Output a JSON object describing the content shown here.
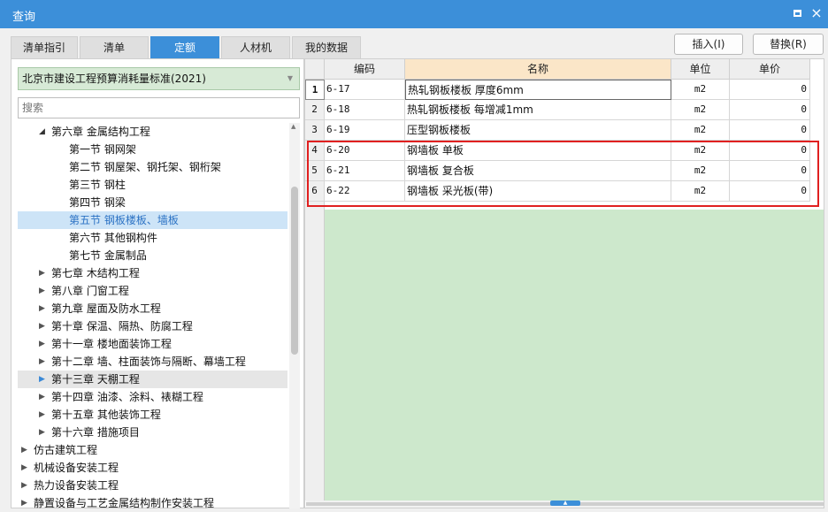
{
  "window": {
    "title": "查询",
    "maximize_label": "",
    "close_label": "×"
  },
  "tabs": [
    "清单指引",
    "清单",
    "定额",
    "人材机",
    "我的数据"
  ],
  "active_tab": 2,
  "actions": {
    "insert": "插入(I)",
    "replace": "替换(R)"
  },
  "library": {
    "selected": "北京市建设工程预算消耗量标准(2021)",
    "search_placeholder": "搜索"
  },
  "tree": [
    {
      "label": "第六章 金属结构工程",
      "level": 1,
      "state": "open"
    },
    {
      "label": "第一节 钢网架",
      "level": 2,
      "state": "leaf"
    },
    {
      "label": "第二节 钢屋架、钢托架、钢桁架",
      "level": 2,
      "state": "leaf"
    },
    {
      "label": "第三节 钢柱",
      "level": 2,
      "state": "leaf"
    },
    {
      "label": "第四节 钢梁",
      "level": 2,
      "state": "leaf"
    },
    {
      "label": "第五节 钢板楼板、墙板",
      "level": 2,
      "state": "leaf",
      "selected": true
    },
    {
      "label": "第六节 其他钢构件",
      "level": 2,
      "state": "leaf"
    },
    {
      "label": "第七节 金属制品",
      "level": 2,
      "state": "leaf"
    },
    {
      "label": "第七章 木结构工程",
      "level": 1,
      "state": "closed"
    },
    {
      "label": "第八章 门窗工程",
      "level": 1,
      "state": "closed"
    },
    {
      "label": "第九章 屋面及防水工程",
      "level": 1,
      "state": "closed"
    },
    {
      "label": "第十章 保温、隔热、防腐工程",
      "level": 1,
      "state": "closed"
    },
    {
      "label": "第十一章 楼地面装饰工程",
      "level": 1,
      "state": "closed"
    },
    {
      "label": "第十二章 墙、柱面装饰与隔断、幕墙工程",
      "level": 1,
      "state": "closed"
    },
    {
      "label": "第十三章 天棚工程",
      "level": 1,
      "state": "closed",
      "hover": true
    },
    {
      "label": "第十四章 油漆、涂料、裱糊工程",
      "level": 1,
      "state": "closed"
    },
    {
      "label": "第十五章 其他装饰工程",
      "level": 1,
      "state": "closed"
    },
    {
      "label": "第十六章 措施项目",
      "level": 1,
      "state": "closed"
    },
    {
      "label": "仿古建筑工程",
      "level": 0,
      "state": "closed"
    },
    {
      "label": "机械设备安装工程",
      "level": 0,
      "state": "closed"
    },
    {
      "label": "热力设备安装工程",
      "level": 0,
      "state": "closed"
    },
    {
      "label": "静置设备与工艺金属结构制作安装工程",
      "level": 0,
      "state": "closed"
    }
  ],
  "table": {
    "headers": {
      "code": "编码",
      "name": "名称",
      "unit": "单位",
      "price": "单价"
    },
    "rows": [
      {
        "no": "1",
        "code": "6-17",
        "name": "热轧钢板楼板 厚度6mm",
        "unit": "m2",
        "price": "0"
      },
      {
        "no": "2",
        "code": "6-18",
        "name": "热轧钢板楼板 每增减1mm",
        "unit": "m2",
        "price": "0"
      },
      {
        "no": "3",
        "code": "6-19",
        "name": "压型钢板楼板",
        "unit": "m2",
        "price": "0"
      },
      {
        "no": "4",
        "code": "6-20",
        "name": "钢墙板 单板",
        "unit": "m2",
        "price": "0"
      },
      {
        "no": "5",
        "code": "6-21",
        "name": "钢墙板 复合板",
        "unit": "m2",
        "price": "0"
      },
      {
        "no": "6",
        "code": "6-22",
        "name": "钢墙板 采光板(带)",
        "unit": "m2",
        "price": "0"
      }
    ]
  },
  "colors": {
    "title_bar": "#3c8fd9",
    "active_tab": "#3c8fd9",
    "grid_fill": "#cde8cc",
    "name_header": "#fbe6c8",
    "highlight": "#e02020"
  }
}
